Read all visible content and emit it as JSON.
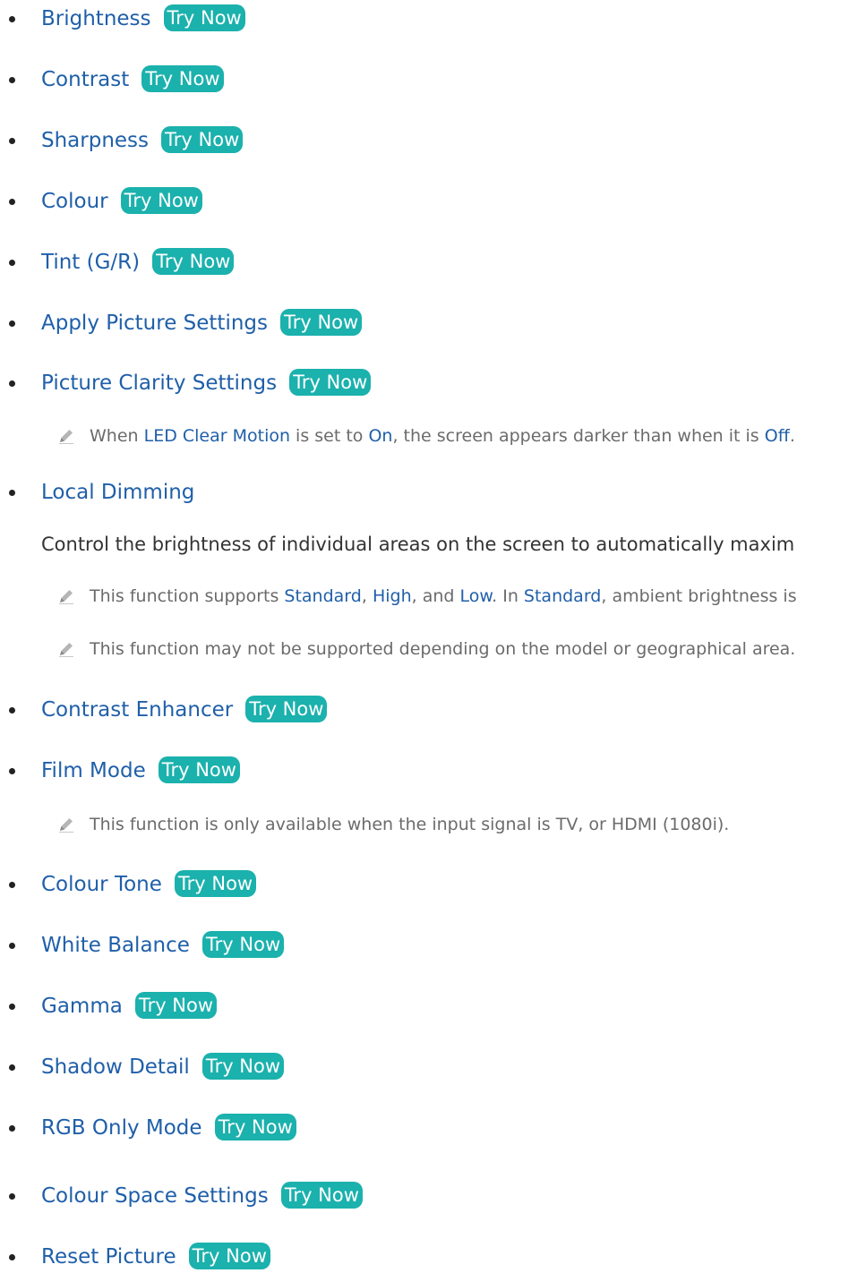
{
  "try_now_label": "Try Now",
  "items": [
    {
      "title": "Brightness"
    },
    {
      "title": "Contrast"
    },
    {
      "title": "Sharpness"
    },
    {
      "title": "Colour"
    },
    {
      "title": "Tint (G/R)"
    },
    {
      "title": "Apply Picture Settings"
    },
    {
      "title": "Picture Clarity Settings"
    },
    {
      "title": "Local Dimming"
    },
    {
      "title": "Contrast Enhancer"
    },
    {
      "title": "Film Mode"
    },
    {
      "title": "Colour Tone"
    },
    {
      "title": "White Balance"
    },
    {
      "title": "Gamma"
    },
    {
      "title": "Shadow Detail"
    },
    {
      "title": "RGB Only Mode"
    },
    {
      "title": "Colour Space Settings"
    },
    {
      "title": "Reset Picture"
    }
  ],
  "notes": {
    "clarity": {
      "t1": "When ",
      "h1": "LED Clear Motion",
      "t2": " is set to ",
      "h2": "On",
      "t3": ", the screen appears darker than when it is ",
      "h3": "Off",
      "t4": "."
    },
    "dimming_desc": "Control the brightness of individual areas on the screen to automatically maxim",
    "dimming_note1": {
      "t1": "This function supports ",
      "h1": "Standard",
      "t2": ", ",
      "h2": "High",
      "t3": ", and ",
      "h3": "Low",
      "t4": ". In ",
      "h4": "Standard",
      "t5": ", ambient brightness is"
    },
    "dimming_note2": "This function may not be supported depending on the model or geographical area.",
    "film_note": "This function is only available when the input signal is TV, or HDMI (1080i)."
  }
}
